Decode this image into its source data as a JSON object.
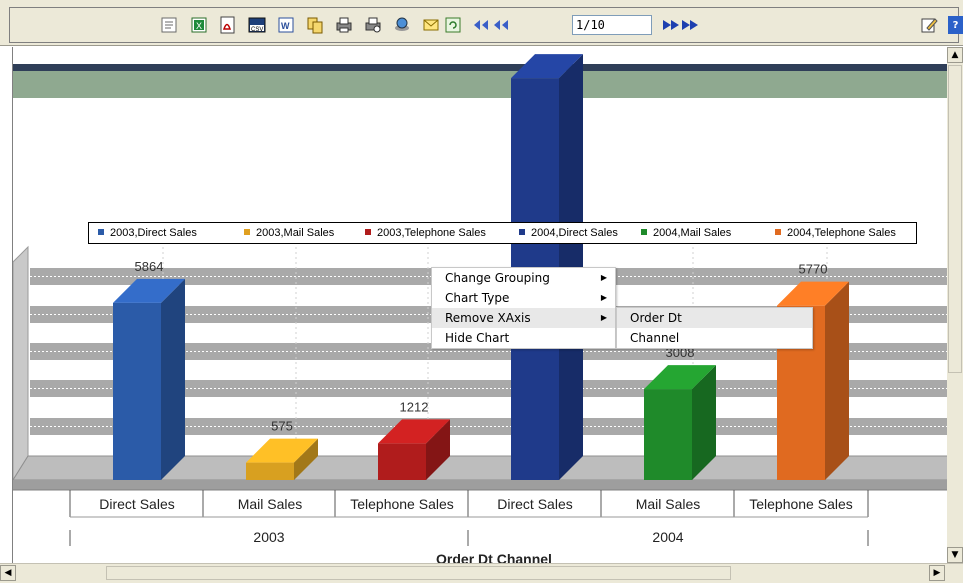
{
  "toolbar": {
    "page_indicator": "1/10",
    "icons": [
      "report-icon",
      "excel-export-icon",
      "pdf-export-icon",
      "csv-export-icon",
      "word-export-icon",
      "copy-icon",
      "print-icon",
      "print-preview-icon",
      "save-icon",
      "email-icon",
      "refresh-icon",
      "first-page-icon",
      "previous-page-icon",
      "next-page-icon",
      "last-page-icon",
      "edit-icon",
      "help-icon"
    ]
  },
  "chart": {
    "legend": [
      {
        "label": "2003,Direct Sales",
        "color": "#2b5ba8"
      },
      {
        "label": "2003,Mail Sales",
        "color": "#e0a020"
      },
      {
        "label": "2003,Telephone Sales",
        "color": "#b01c1c"
      },
      {
        "label": "2004,Direct Sales",
        "color": "#1f3a8a"
      },
      {
        "label": "2004,Mail Sales",
        "color": "#1f8a2a"
      },
      {
        "label": "2004,Telephone Sales",
        "color": "#e06a20"
      }
    ],
    "axis_title": "Order Dt Channel",
    "groups": [
      "2003",
      "2004"
    ]
  },
  "chart_data": {
    "type": "bar",
    "categories": [
      "Direct Sales",
      "Mail Sales",
      "Telephone Sales",
      "Direct Sales",
      "Mail Sales",
      "Telephone Sales"
    ],
    "group_labels": [
      "2003",
      "2004"
    ],
    "series": [
      {
        "name": "2003,Direct Sales",
        "values": [
          5864
        ]
      },
      {
        "name": "2003,Mail Sales",
        "values": [
          575
        ]
      },
      {
        "name": "2003,Telephone Sales",
        "values": [
          1212
        ]
      },
      {
        "name": "2004,Direct Sales",
        "values": [
          null
        ]
      },
      {
        "name": "2004,Mail Sales",
        "values": [
          3008
        ]
      },
      {
        "name": "2004,Telephone Sales",
        "values": [
          5770
        ]
      }
    ],
    "values": [
      5864,
      575,
      1212,
      13300,
      3008,
      5770
    ],
    "labels": [
      "5864",
      "575",
      "1212",
      "",
      "3008",
      "5770"
    ],
    "colors": [
      "#2b5ba8",
      "#d8a020",
      "#b01c1c",
      "#1f3a8a",
      "#1f8a2a",
      "#e06a20"
    ],
    "xlabel": "Order Dt Channel",
    "ylabel": "",
    "ylim": [
      0,
      14000
    ],
    "grid": true,
    "legend_position": "top"
  },
  "context_menu": {
    "items": [
      {
        "label": "Change Grouping",
        "has_submenu": true
      },
      {
        "label": "Chart Type",
        "has_submenu": true
      },
      {
        "label": "Remove XAxis",
        "has_submenu": true,
        "active": true
      },
      {
        "label": "Hide Chart",
        "has_submenu": false
      }
    ],
    "submenu": [
      {
        "label": "Order Dt",
        "active": true
      },
      {
        "label": "Channel",
        "active": false
      }
    ]
  }
}
